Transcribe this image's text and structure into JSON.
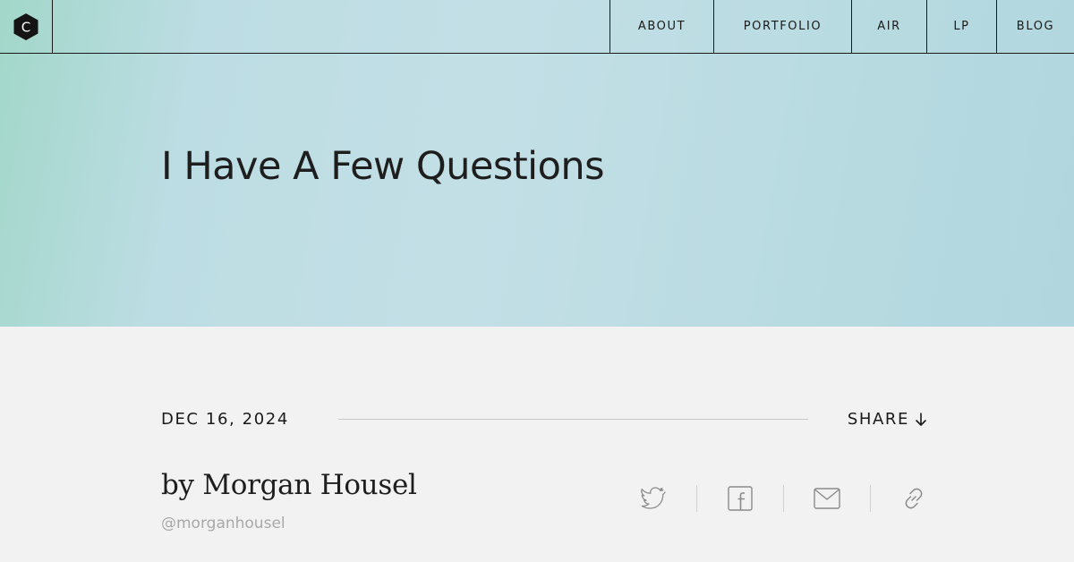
{
  "logo": {
    "letter": "C"
  },
  "nav": {
    "items": [
      {
        "label": "ABOUT"
      },
      {
        "label": "PORTFOLIO"
      },
      {
        "label": "AIR"
      },
      {
        "label": "LP"
      },
      {
        "label": "BLOG"
      }
    ]
  },
  "article": {
    "title": "I Have A Few Questions",
    "date": "DEC 16, 2024",
    "share_label": "SHARE",
    "author_line": "by Morgan Housel",
    "handle": "@morganhousel"
  },
  "share_icons": [
    "twitter-icon",
    "facebook-icon",
    "email-icon",
    "link-icon"
  ],
  "colors": {
    "hero_gradient_start": "#a2d7c9",
    "hero_gradient_mid": "#c3dfe6",
    "hero_gradient_end": "#b1d6de",
    "page_background": "#f2f2f2",
    "ink": "#1a1a1a",
    "muted": "#a8a8a8",
    "icon_gray": "#8a8a8a"
  }
}
